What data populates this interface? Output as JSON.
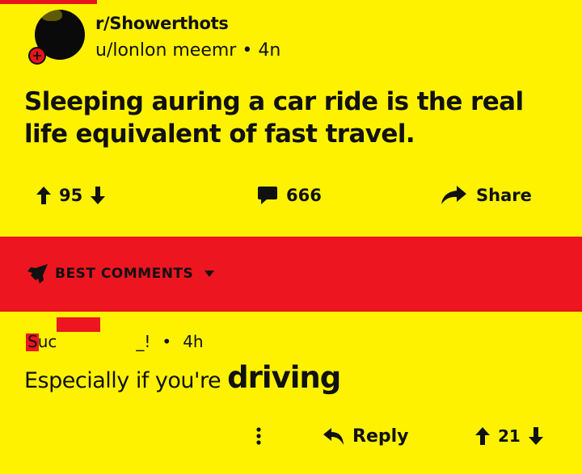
{
  "post": {
    "subreddit": "r/Showerthots",
    "author": "u/lonlon meemr",
    "age": "4n",
    "title": "Sleeping auring a car ride is the real life equivalent of fast travel.",
    "upvotes": "95",
    "comments": "666",
    "share_label": "Share"
  },
  "comments_header": {
    "label": "BEST COMMENTS"
  },
  "comment": {
    "username_start": "Suc",
    "username_end": "_!",
    "age": "4h",
    "text": "Especially if you're",
    "text_big": "driving",
    "reply_label": "Reply",
    "votes": "21"
  },
  "colors": {
    "background": "#fff200",
    "band": "#ed1520",
    "text": "#111111"
  }
}
